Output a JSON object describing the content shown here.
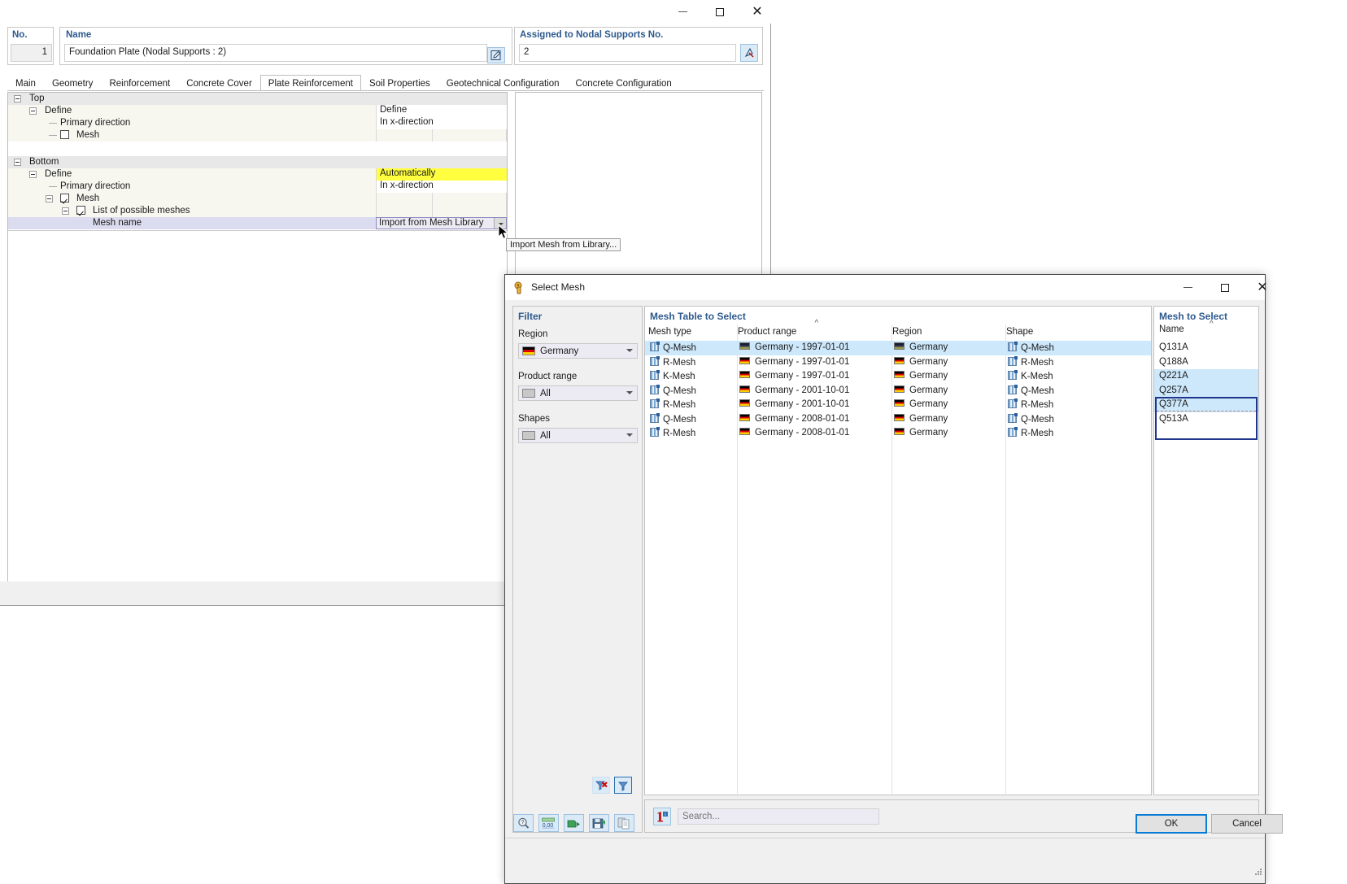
{
  "background_window": {
    "title_controls": {
      "minimize": "–",
      "maximize": "□",
      "close": "×"
    },
    "no_field": {
      "label": "No.",
      "value": "1"
    },
    "name_field": {
      "label": "Name",
      "value": "Foundation Plate (Nodal Supports : 2)",
      "edit_icon": "edit-pencil-icon"
    },
    "assigned_field": {
      "label": "Assigned to Nodal Supports No.",
      "value": "2",
      "pick_icon": "pick-object-icon"
    },
    "tabs": [
      {
        "label": "Main",
        "active": false
      },
      {
        "label": "Geometry",
        "active": false
      },
      {
        "label": "Reinforcement",
        "active": false
      },
      {
        "label": "Concrete Cover",
        "active": false
      },
      {
        "label": "Plate Reinforcement",
        "active": true
      },
      {
        "label": "Soil Properties",
        "active": false
      },
      {
        "label": "Geotechnical Configuration",
        "active": false
      },
      {
        "label": "Concrete Configuration",
        "active": false
      }
    ],
    "tree": {
      "top_group": "Top",
      "top_define_label": "Define",
      "top_define_value": "Define",
      "top_primary_label": "Primary direction",
      "top_primary_value": "In x-direction",
      "top_mesh_label": "Mesh",
      "top_mesh_checked": false,
      "bottom_group": "Bottom",
      "bottom_define_label": "Define",
      "bottom_define_value": "Automatically",
      "bottom_primary_label": "Primary direction",
      "bottom_primary_value": "In x-direction",
      "bottom_mesh_label": "Mesh",
      "bottom_mesh_checked": true,
      "list_label": "List of possible meshes",
      "list_checked": true,
      "mesh_name_label": "Mesh name",
      "mesh_name_value": "Import from Mesh Library"
    },
    "tooltip": "Import Mesh from Library..."
  },
  "dialog": {
    "title": "Select Mesh",
    "icon": "mesh-library-icon",
    "title_controls": {
      "minimize": "–",
      "maximize": "□",
      "close": "×"
    },
    "filter": {
      "caption": "Filter",
      "region": {
        "label": "Region",
        "value": "Germany",
        "swatch": "flag-germany"
      },
      "product_range": {
        "label": "Product range",
        "value": "All",
        "swatch": "flag-none"
      },
      "shapes": {
        "label": "Shapes",
        "value": "All",
        "swatch": "flag-none"
      },
      "clear_filter_icon": "clear-filter-icon",
      "apply_filter_icon": "apply-filter-icon"
    },
    "table": {
      "caption": "Mesh Table to Select",
      "columns": [
        "Mesh type",
        "Product range",
        "Region",
        "Shape"
      ],
      "sorted_column": "Product range",
      "sort_direction": "ascending",
      "rows": [
        {
          "mesh_type": "Q-Mesh",
          "product_range": "Germany - 1997-01-01",
          "region": "Germany",
          "shape": "Q-Mesh",
          "selected": true
        },
        {
          "mesh_type": "R-Mesh",
          "product_range": "Germany - 1997-01-01",
          "region": "Germany",
          "shape": "R-Mesh",
          "selected": false
        },
        {
          "mesh_type": "K-Mesh",
          "product_range": "Germany - 1997-01-01",
          "region": "Germany",
          "shape": "K-Mesh",
          "selected": false
        },
        {
          "mesh_type": "Q-Mesh",
          "product_range": "Germany - 2001-10-01",
          "region": "Germany",
          "shape": "Q-Mesh",
          "selected": false
        },
        {
          "mesh_type": "R-Mesh",
          "product_range": "Germany - 2001-10-01",
          "region": "Germany",
          "shape": "R-Mesh",
          "selected": false
        },
        {
          "mesh_type": "Q-Mesh",
          "product_range": "Germany - 2008-01-01",
          "region": "Germany",
          "shape": "Q-Mesh",
          "selected": false
        },
        {
          "mesh_type": "R-Mesh",
          "product_range": "Germany - 2008-01-01",
          "region": "Germany",
          "shape": "R-Mesh",
          "selected": false
        }
      ]
    },
    "mesh_to_select": {
      "caption": "Mesh to Select",
      "column": "Name",
      "sort_direction": "ascending",
      "rows": [
        {
          "name": "Q131A",
          "highlighted": false
        },
        {
          "name": "Q188A",
          "highlighted": false
        },
        {
          "name": "Q221A",
          "highlighted": true
        },
        {
          "name": "Q257A",
          "highlighted": true
        },
        {
          "name": "Q377A",
          "highlighted": true
        },
        {
          "name": "Q513A",
          "highlighted": false
        }
      ]
    },
    "search": {
      "placeholder": "Search...",
      "value": "",
      "icon": "info-search-icon"
    },
    "footer_icons": [
      "help-magnifier-icon",
      "units-icon",
      "export-icon",
      "save-icon",
      "copy-icon"
    ],
    "ok_label": "OK",
    "cancel_label": "Cancel"
  }
}
